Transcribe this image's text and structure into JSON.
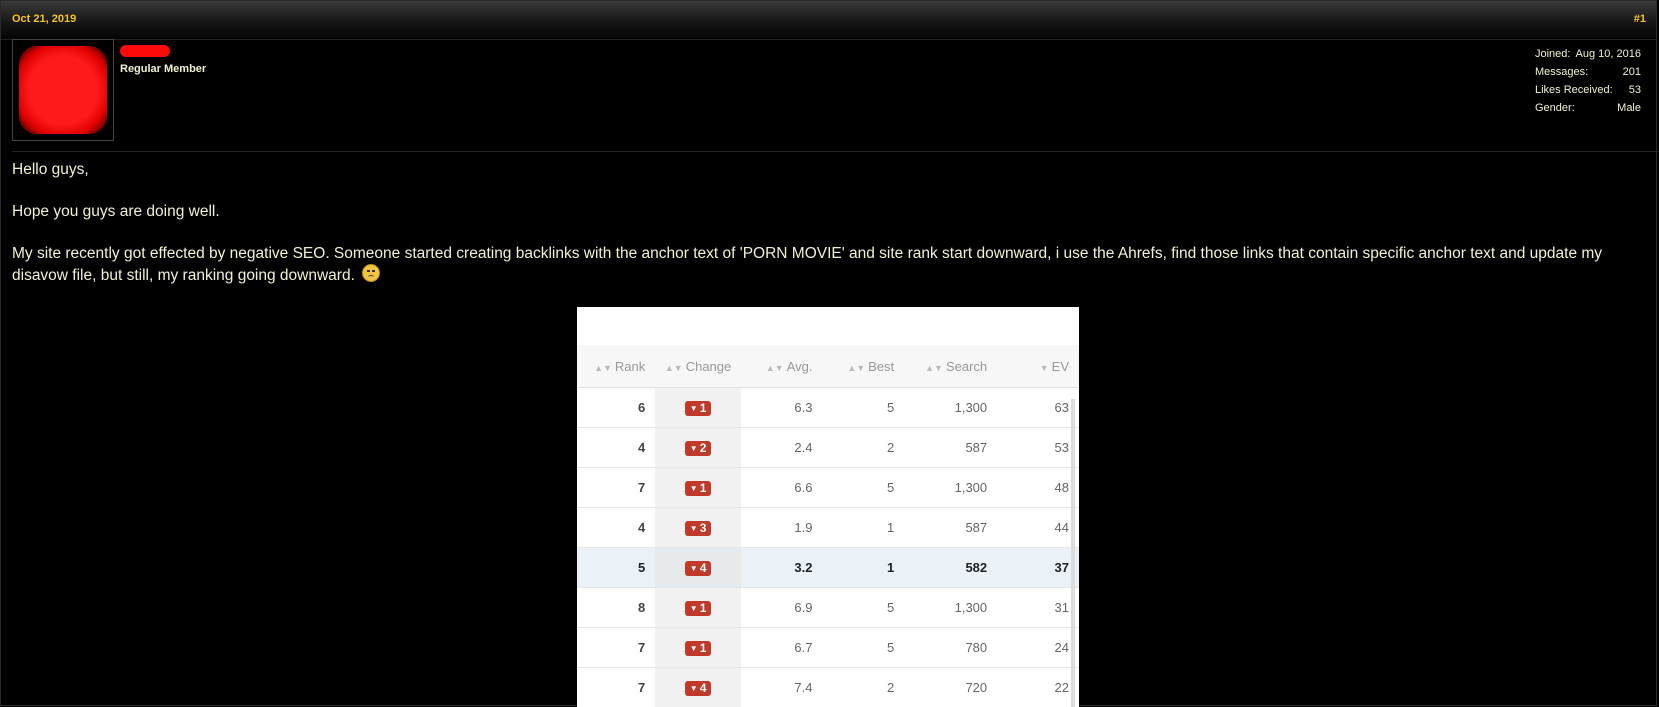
{
  "post": {
    "date": "Oct 21, 2019",
    "number": "#1"
  },
  "user": {
    "title": "Regular Member",
    "stats": [
      {
        "label": "Joined:",
        "value": "Aug 10, 2016"
      },
      {
        "label": "Messages:",
        "value": "201"
      },
      {
        "label": "Likes Received:",
        "value": "53"
      },
      {
        "label": "Gender:",
        "value": "Male"
      }
    ]
  },
  "content": {
    "p1": "Hello guys,",
    "p2": "Hope you guys are doing well.",
    "p3": "My site recently got effected by negative SEO. Someone started creating backlinks with the anchor text of 'PORN MOVIE' and site rank start downward, i use the Ahrefs, find those links that contain specific anchor text and update my disavow file, but still, my ranking going downward."
  },
  "table": {
    "headers": [
      "Rank",
      "Change",
      "Avg.",
      "Best",
      "Search",
      "EV"
    ],
    "rows": [
      {
        "rank": "6",
        "change": "1",
        "avg": "6.3",
        "best": "5",
        "search": "1,300",
        "ev": "63"
      },
      {
        "rank": "4",
        "change": "2",
        "avg": "2.4",
        "best": "2",
        "search": "587",
        "ev": "53"
      },
      {
        "rank": "7",
        "change": "1",
        "avg": "6.6",
        "best": "5",
        "search": "1,300",
        "ev": "48"
      },
      {
        "rank": "4",
        "change": "3",
        "avg": "1.9",
        "best": "1",
        "search": "587",
        "ev": "44"
      },
      {
        "rank": "5",
        "change": "4",
        "avg": "3.2",
        "best": "1",
        "search": "582",
        "ev": "37"
      },
      {
        "rank": "8",
        "change": "1",
        "avg": "6.9",
        "best": "5",
        "search": "1,300",
        "ev": "31"
      },
      {
        "rank": "7",
        "change": "1",
        "avg": "6.7",
        "best": "5",
        "search": "780",
        "ev": "24"
      },
      {
        "rank": "7",
        "change": "4",
        "avg": "7.4",
        "best": "2",
        "search": "720",
        "ev": "22"
      }
    ],
    "highlighted_row": 4
  },
  "colors": {
    "accent": "#f5c518",
    "text": "#f2f2d0",
    "badge": "#c0392b"
  }
}
